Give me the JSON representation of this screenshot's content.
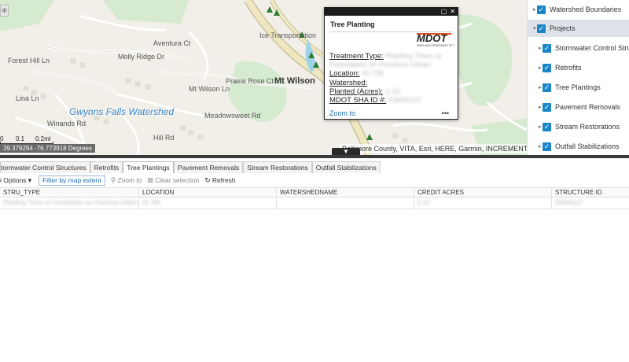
{
  "map": {
    "labels": {
      "aventura_ct": "Aventura Ct",
      "molly_ridge_dr": "Molly Ridge Dr",
      "mt_wilson": "Mt Wilson",
      "watershed": "Gwynns Falls Watershed",
      "mt_wilson_ln": "Mt Wilson Ln",
      "prairie_rose_ct": "Prairie Rose Ct",
      "meadowsweet_rd": "Meadowsweet Rd",
      "winands_rd": "Winands Rd",
      "lina_ln": "Lina Ln",
      "hill_rd": "Hill Rd",
      "forest_hill_ln": "Forest Hill Ln",
      "icc_transportation": "Ice Transportation"
    },
    "scale": {
      "tick0": "0",
      "tick1": "0.1",
      "tick2": "0.2mi"
    },
    "coordinates": "39.379294 -76.773918 Degrees",
    "attribution": "Baltimore County, VITA, Esri, HERE, Garmin, INCREMENT P,"
  },
  "popup": {
    "title": "Tree Planting",
    "logo_text": "MDOT",
    "logo_subtext": "MARYLAND DEPARTMENT OF TRANSPORTATION",
    "fields": [
      {
        "label": "Treatment Type:",
        "value": "Planting Trees or Forestation on Pervious Urban"
      },
      {
        "label": "Location:",
        "value": "IS 795"
      },
      {
        "label": "Watershed:",
        "value": ""
      },
      {
        "label": "Planted (Acres):",
        "value": "2.10"
      },
      {
        "label": "MDOT SHA ID #:",
        "value": "03600127"
      }
    ],
    "zoom_link": "Zoom to",
    "more": "•••"
  },
  "layers": [
    {
      "label": "Watershed Boundaries",
      "checked": true
    },
    {
      "label": "Projects",
      "checked": true,
      "expanded": true
    },
    {
      "label": "Stormwater Control Structures",
      "checked": true
    },
    {
      "label": "Retrofits",
      "checked": true
    },
    {
      "label": "Tree Plantings",
      "checked": true
    },
    {
      "label": "Pavement Removals",
      "checked": true
    },
    {
      "label": "Stream Restorations",
      "checked": true
    },
    {
      "label": "Outfall Stabilizations",
      "checked": true
    }
  ],
  "table": {
    "tabs": [
      "tormwater Control Structures",
      "Retrofits",
      "Tree Plantings",
      "Pavement Removals",
      "Stream Restorations",
      "Outfall Stabilizations"
    ],
    "active_tab": 2,
    "toolbar": {
      "options": "Options",
      "filter": "Filter by map extent",
      "zoom": "Zoom to",
      "clear": "Clear selection",
      "refresh": "Refresh"
    },
    "columns": [
      "STRU_TYPE",
      "LOCATION",
      "WATERSHEDNAME",
      "CREDIT ACRES",
      "STRUCTURE ID"
    ],
    "rows": [
      [
        "Planting Trees or Forestation on Pervious Urban",
        "IS 795",
        "",
        "2.10",
        "03600127"
      ]
    ]
  },
  "colors": {
    "accent": "#1a86c7",
    "link": "#1a6fb3",
    "map_bg": "#f1efe8",
    "road": "#ffffff",
    "highway": "#e8e0b0",
    "park": "#d6ead0"
  }
}
